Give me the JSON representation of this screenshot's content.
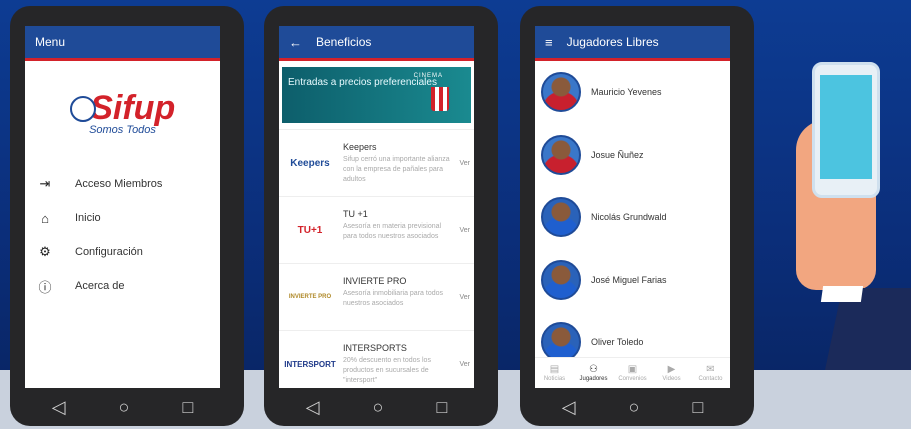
{
  "menu_screen": {
    "title": "Menu",
    "logo_text": "Sifup",
    "logo_tagline": "Somos Todos",
    "items": [
      {
        "label": "Acceso Miembros",
        "icon": "login-icon"
      },
      {
        "label": "Inicio",
        "icon": "home-icon"
      },
      {
        "label": "Configuración",
        "icon": "gear-icon"
      },
      {
        "label": "Acerca de",
        "icon": "info-icon"
      }
    ]
  },
  "benefits_screen": {
    "title": "Beneficios",
    "banner_text": "Entradas a precios preferenciales",
    "banner_brand": "CINEMA",
    "items": [
      {
        "name": "Keepers",
        "logo": "Keepers",
        "desc": "Sifup cerró una importante alianza con la empresa de pañales para adultos",
        "action": "Ver"
      },
      {
        "name": "TU +1",
        "logo": "TU+1",
        "desc": "Asesoría en materia previsional para todos nuestros asociados",
        "action": "Ver"
      },
      {
        "name": "INVIERTE PRO",
        "logo": "INVIERTE PRO",
        "desc": "Asesoría inmobiliaria para todos nuestros asociados",
        "action": "Ver"
      },
      {
        "name": "INTERSPORTS",
        "logo": "INTERSPORT",
        "desc": "20% descuento en todos los productos en sucursales de \"intersport\"",
        "action": "Ver"
      }
    ]
  },
  "players_screen": {
    "title": "Jugadores Libres",
    "players": [
      {
        "name": "Mauricio Yevenes"
      },
      {
        "name": "Josue Ñuñez"
      },
      {
        "name": "Nicolás Grundwald"
      },
      {
        "name": "José Miguel Farias"
      },
      {
        "name": "Oliver Toledo"
      }
    ],
    "tabs": [
      {
        "label": "Noticias",
        "icon": "news-icon"
      },
      {
        "label": "Jugadores",
        "icon": "players-icon"
      },
      {
        "label": "Convenios",
        "icon": "deals-icon"
      },
      {
        "label": "Videos",
        "icon": "video-icon"
      },
      {
        "label": "Contacto",
        "icon": "contact-icon"
      }
    ]
  },
  "colors": {
    "appbar": "#1f4b98",
    "accent": "#d3222a",
    "background": "#0d3c93"
  }
}
